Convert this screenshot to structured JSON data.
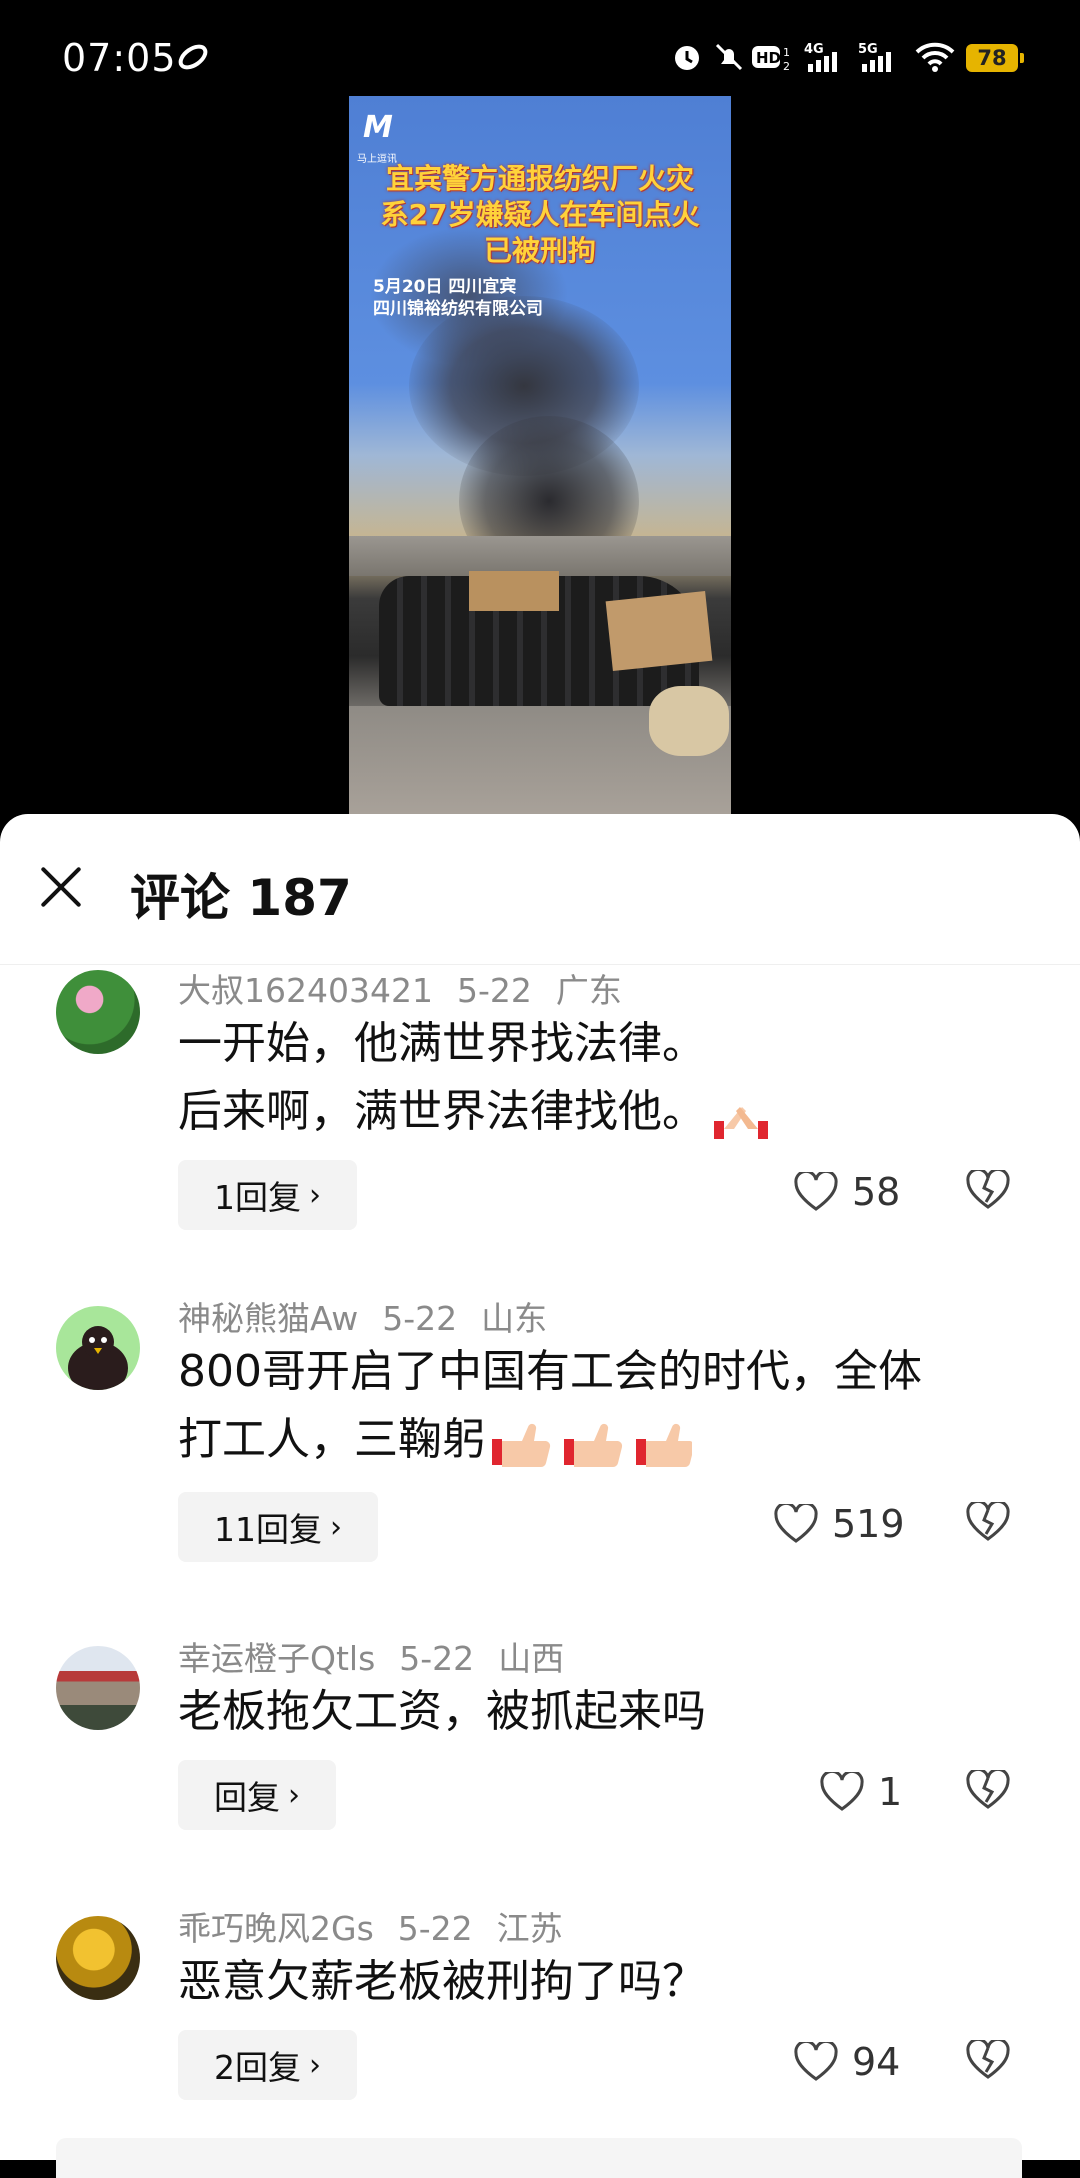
{
  "status_bar": {
    "time": "07:05",
    "battery": "78",
    "icons": [
      "alarm-icon",
      "mute-icon",
      "hd-icon",
      "4g-signal-icon",
      "5g-signal-icon",
      "wifi-icon"
    ]
  },
  "video": {
    "logo_sub": "马上逗讯",
    "title_lines": [
      "宜宾警方通报纺织厂火灾",
      "系27岁嫌疑人在车间点火",
      "已被刑拘"
    ],
    "sub_lines": [
      "5月20日 四川宜宾",
      "四川锦裕纺织有限公司"
    ]
  },
  "header": {
    "title": "评论 187"
  },
  "comments": [
    {
      "user": "大叔162403421",
      "date": "5-22",
      "location": "广东",
      "lines": [
        "一开始，他满世界找法律。",
        "后来啊，满世界法律找他。"
      ],
      "emoji": "clap-hands-emoji",
      "reply_label": "1回复",
      "likes": "58"
    },
    {
      "user": "神秘熊猫Aw",
      "date": "5-22",
      "location": "山东",
      "lines": [
        "800哥开启了中国有工会的时代，全体",
        "打工人，三鞠躬"
      ],
      "emoji": "thumbs-up-emoji",
      "reply_label": "11回复",
      "likes": "519"
    },
    {
      "user": "幸运橙子Qtls",
      "date": "5-22",
      "location": "山西",
      "lines": [
        "老板拖欠工资，被抓起来吗"
      ],
      "reply_label": "回复",
      "likes": "1"
    },
    {
      "user": "乖巧晚风2Gs",
      "date": "5-22",
      "location": "江苏",
      "lines": [
        "恶意欠薪老板被刑拘了吗？"
      ],
      "reply_label": "2回复",
      "likes": "94"
    }
  ]
}
